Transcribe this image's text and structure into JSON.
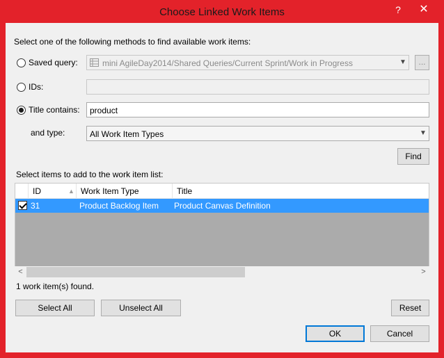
{
  "window": {
    "title": "Choose Linked Work Items",
    "help_label": "?",
    "close_label": "✕"
  },
  "methods": {
    "instructions": "Select one of the following methods to find available work items:",
    "saved_query": {
      "label": "Saved query:",
      "value": "mini AgileDay2014/Shared Queries/Current Sprint/Work in Progress",
      "browse_label": "...",
      "checked": false
    },
    "ids": {
      "label": "IDs:",
      "value": "",
      "checked": false
    },
    "title_contains": {
      "label": "Title contains:",
      "value": "product",
      "checked": true
    },
    "type": {
      "label": "and type:",
      "value": "All Work Item Types"
    },
    "find_label": "Find"
  },
  "results": {
    "instructions": "Select items to add to the work item list:",
    "columns": [
      "ID",
      "Work Item Type",
      "Title"
    ],
    "rows": [
      {
        "checked": true,
        "id": "31",
        "type": "Product Backlog Item",
        "title": "Product Canvas Definition"
      }
    ],
    "status": "1 work item(s) found."
  },
  "buttons": {
    "select_all": "Select All",
    "unselect_all": "Unselect All",
    "reset": "Reset",
    "ok": "OK",
    "cancel": "Cancel"
  },
  "colors": {
    "title_bar": "#e3222a",
    "selection": "#3399ff"
  }
}
